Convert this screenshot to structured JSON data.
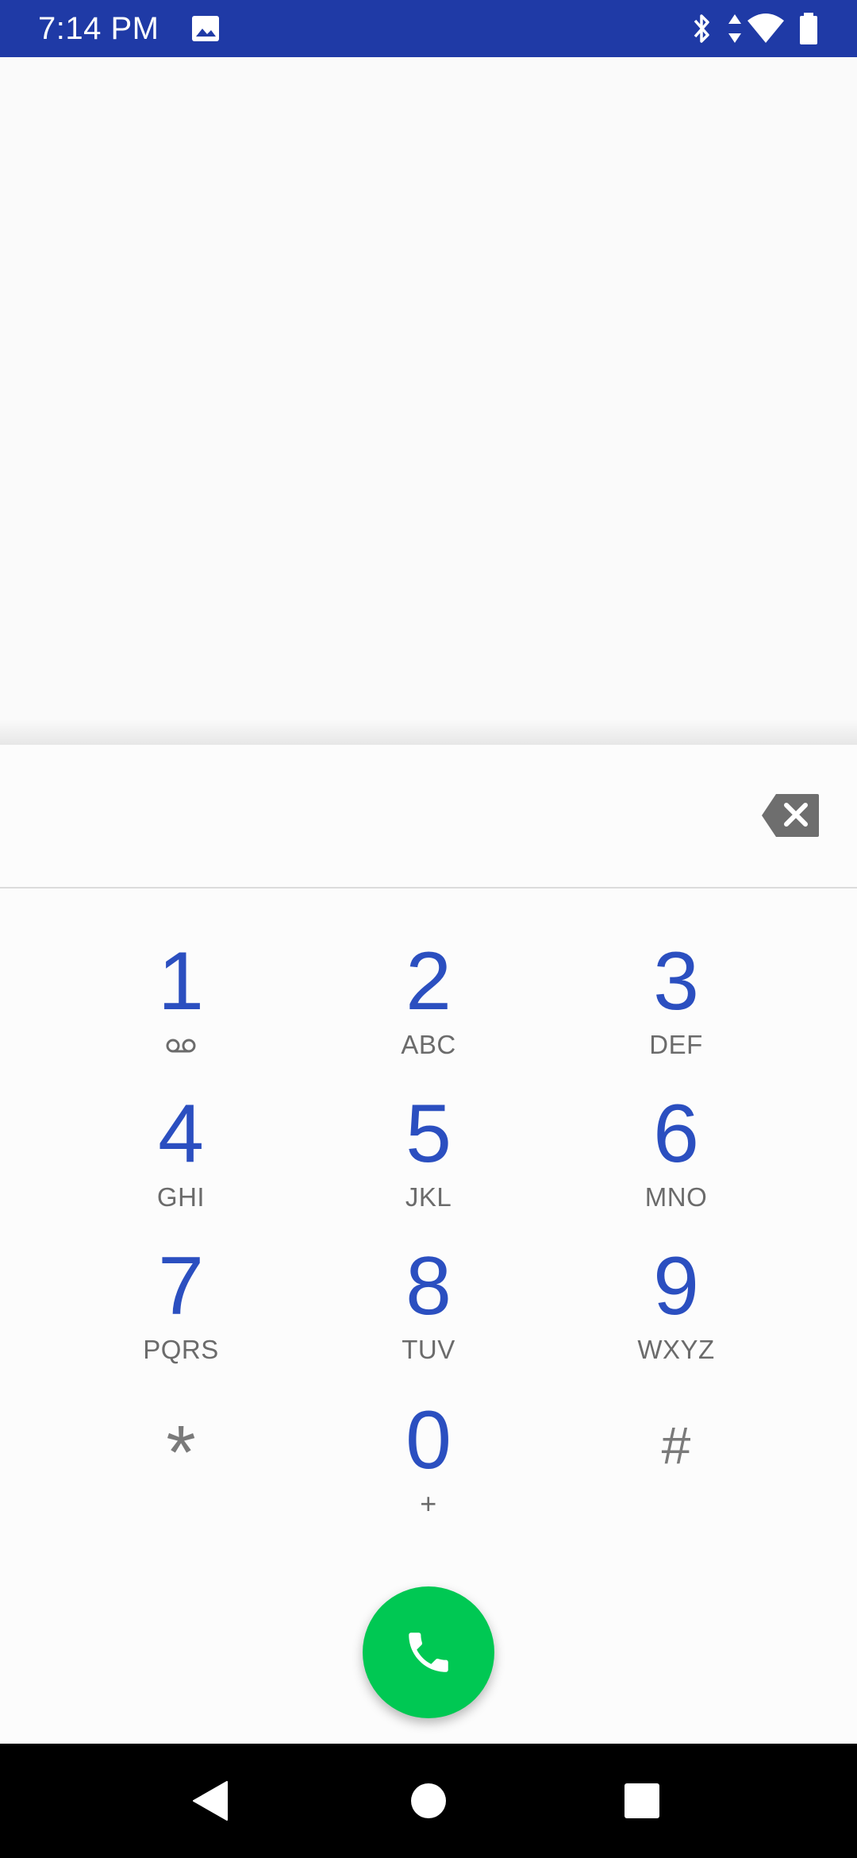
{
  "status_bar": {
    "time": "7:14 PM",
    "icons": [
      "image-notification-icon",
      "bluetooth-icon",
      "data-transfer-icon",
      "wifi-icon",
      "battery-icon"
    ],
    "background": "#1f3aa6"
  },
  "dialer": {
    "digits_value": "",
    "backspace_icon": "backspace-icon",
    "keys": [
      {
        "digit": "1",
        "letters": "",
        "icon": "voicemail-icon"
      },
      {
        "digit": "2",
        "letters": "ABC"
      },
      {
        "digit": "3",
        "letters": "DEF"
      },
      {
        "digit": "4",
        "letters": "GHI"
      },
      {
        "digit": "5",
        "letters": "JKL"
      },
      {
        "digit": "6",
        "letters": "MNO"
      },
      {
        "digit": "7",
        "letters": "PQRS"
      },
      {
        "digit": "8",
        "letters": "TUV"
      },
      {
        "digit": "9",
        "letters": "WXYZ"
      },
      {
        "digit": "*",
        "letters": ""
      },
      {
        "digit": "0",
        "letters": "+"
      },
      {
        "digit": "#",
        "letters": ""
      }
    ],
    "digit_color": "#2b4fc0",
    "letters_color": "#6b6b6b",
    "call_button_icon": "phone-icon",
    "call_button_color": "#00c853"
  },
  "nav_bar": {
    "buttons": [
      "back-icon",
      "home-icon",
      "recents-icon"
    ]
  }
}
